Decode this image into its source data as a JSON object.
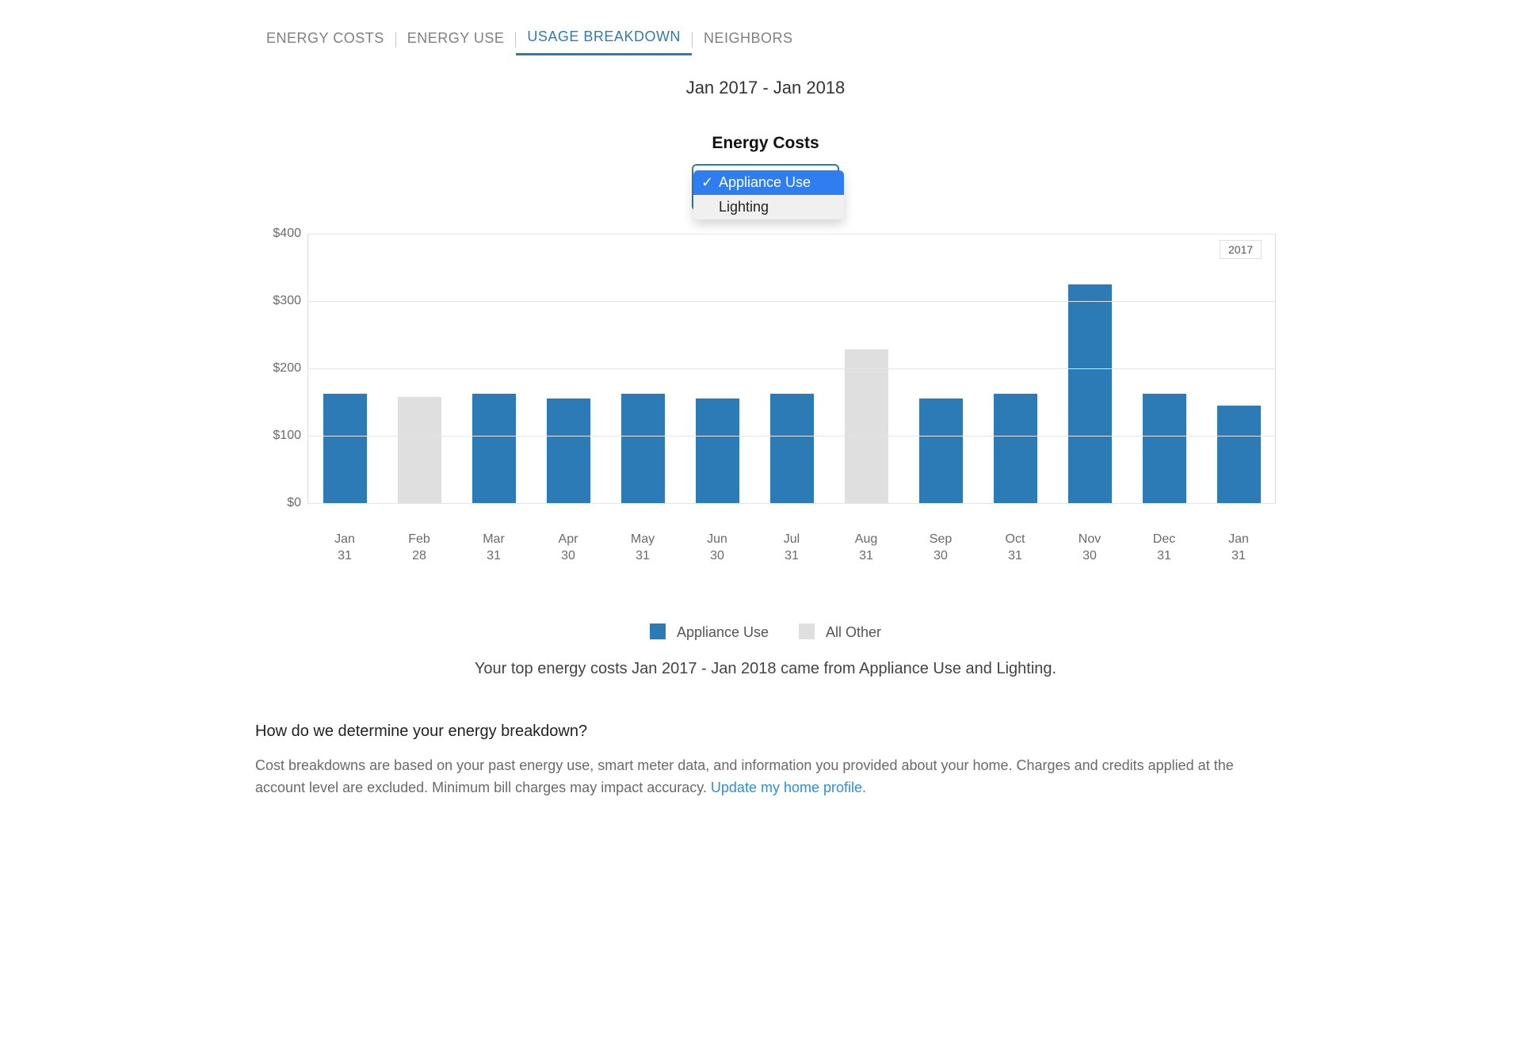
{
  "tabs": {
    "items": [
      "ENERGY COSTS",
      "ENERGY USE",
      "USAGE BREAKDOWN",
      "NEIGHBORS"
    ],
    "active_index": 2
  },
  "date_range": "Jan 2017 - Jan 2018",
  "metric_title": "Energy Costs",
  "selector": {
    "options": [
      {
        "label": "Appliance Use",
        "selected": true
      },
      {
        "label": "Lighting",
        "selected": false
      }
    ]
  },
  "legend": {
    "primary": "Appliance Use",
    "other": "All Other"
  },
  "year_badge": "2017",
  "summary_text": "Your top energy costs Jan 2017 - Jan 2018 came from Appliance Use and Lighting.",
  "faq": {
    "question": "How do we determine your energy breakdown?",
    "answer_pre": "Cost breakdowns are based on your past energy use, smart meter data, and information you provided about your home. Charges and credits applied at the account level are excluded. Minimum bill charges may impact accuracy. ",
    "answer_link": "Update my home profile."
  },
  "chart_data": {
    "type": "bar",
    "title": "Energy Costs",
    "ylabel": "$",
    "ylim": [
      0,
      400
    ],
    "yticks": [
      0,
      100,
      200,
      300,
      400
    ],
    "categories": [
      {
        "month": "Jan",
        "day": "31"
      },
      {
        "month": "Feb",
        "day": "28"
      },
      {
        "month": "Mar",
        "day": "31"
      },
      {
        "month": "Apr",
        "day": "30"
      },
      {
        "month": "May",
        "day": "31"
      },
      {
        "month": "Jun",
        "day": "30"
      },
      {
        "month": "Jul",
        "day": "31"
      },
      {
        "month": "Aug",
        "day": "31"
      },
      {
        "month": "Sep",
        "day": "30"
      },
      {
        "month": "Oct",
        "day": "31"
      },
      {
        "month": "Nov",
        "day": "30"
      },
      {
        "month": "Dec",
        "day": "31"
      },
      {
        "month": "Jan",
        "day": "31"
      }
    ],
    "series": [
      {
        "name": "Appliance Use",
        "kind": "primary",
        "values": [
          162,
          null,
          162,
          155,
          162,
          155,
          162,
          null,
          155,
          162,
          325,
          162,
          145
        ]
      },
      {
        "name": "All Other",
        "kind": "other",
        "values": [
          null,
          158,
          null,
          null,
          null,
          null,
          null,
          228,
          null,
          null,
          null,
          null,
          null
        ]
      }
    ]
  },
  "colors": {
    "primary": "#2d7bb6",
    "other": "#dfdfdf",
    "grid": "#e5e5e5",
    "tab_active": "#2d7bb6"
  }
}
